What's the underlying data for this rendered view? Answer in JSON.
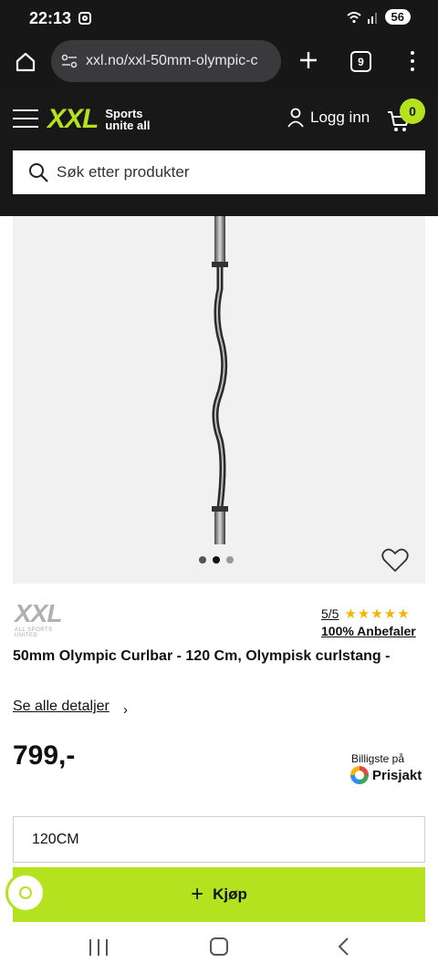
{
  "status_bar": {
    "time": "22:13",
    "battery": "56"
  },
  "browser": {
    "url": "xxl.no/xxl-50mm-olympic-c",
    "tab_count": "9"
  },
  "header": {
    "logo_mark": "XXL",
    "logo_tagline_1": "Sports",
    "logo_tagline_2": "unite all",
    "login_label": "Logg inn",
    "cart_count": "0",
    "search_placeholder": "Søk etter produkter"
  },
  "gallery": {
    "image_count": 3,
    "active_index": 1
  },
  "product": {
    "brand_logo_text": "XXL",
    "brand_logo_subtext": "ALL SPORTS UNITED",
    "rating": "5/5",
    "stars": "★★★★★",
    "recommend": "100% Anbefaler",
    "title": "50mm Olympic Curlbar - 120 Cm, Olympisk curlstang -",
    "details_link": "Se alle detaljer",
    "price": "799,-",
    "prisjakt_label": "Billigste på",
    "prisjakt_name": "Prisjakt",
    "size_value": "120CM",
    "buy_label": "Kjøp"
  },
  "colors": {
    "accent": "#b4e21e",
    "header_bg": "#181818"
  }
}
